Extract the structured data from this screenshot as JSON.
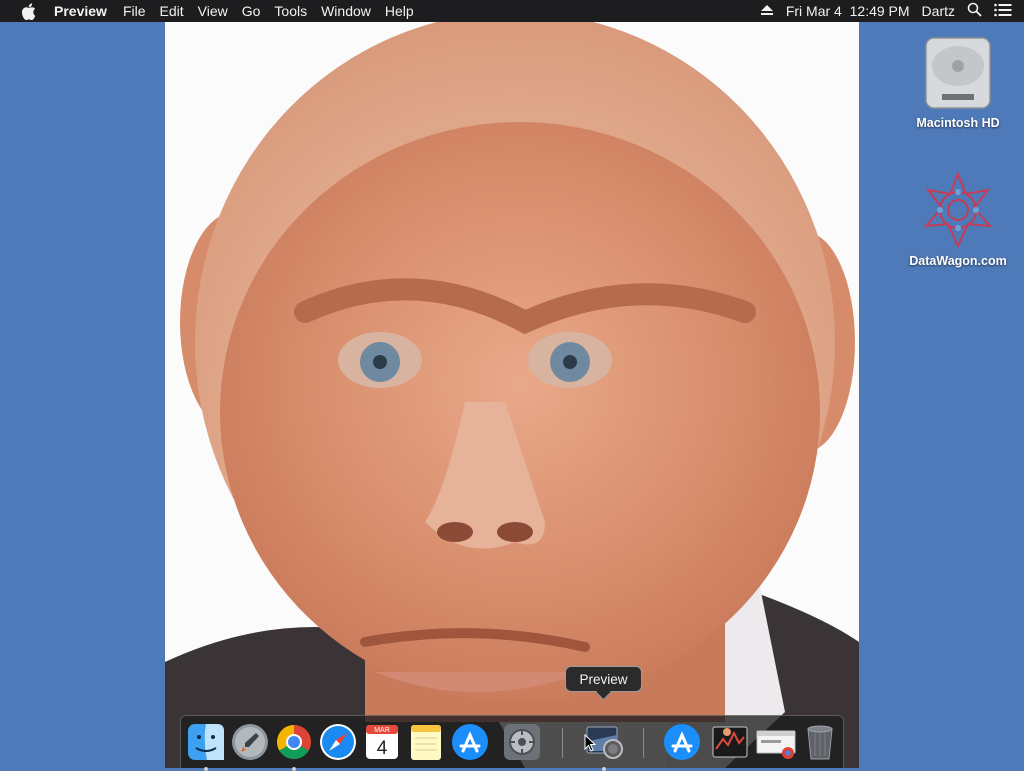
{
  "menubar": {
    "apple_icon": "apple-icon",
    "app_name": "Preview",
    "menus": [
      "File",
      "Edit",
      "View",
      "Go",
      "Tools",
      "Window",
      "Help"
    ],
    "status": {
      "eject_icon": "eject-icon",
      "datetime": "Fri Mar 4  12:49 PM",
      "user": "Dartz",
      "search_icon": "spotlight-search-icon",
      "list_icon": "notification-center-icon"
    }
  },
  "desktop": {
    "icons": [
      {
        "label": "Macintosh HD",
        "icon": "hard-drive-icon"
      },
      {
        "label": "DataWagon.com",
        "icon": "datawagon-icon"
      }
    ]
  },
  "dock": {
    "tooltip": "Preview",
    "calendar": {
      "month": "MAR",
      "day": "4"
    },
    "items": [
      {
        "name": "Finder",
        "icon": "finder-icon",
        "running": true
      },
      {
        "name": "Launchpad",
        "icon": "launchpad-icon",
        "running": false
      },
      {
        "name": "Google Chrome",
        "icon": "chrome-icon",
        "running": true
      },
      {
        "name": "Safari",
        "icon": "safari-icon",
        "running": false
      },
      {
        "name": "Calendar",
        "icon": "calendar-icon",
        "running": false
      },
      {
        "name": "Notes",
        "icon": "notes-icon",
        "running": false
      },
      {
        "name": "App Store",
        "icon": "app-store-icon",
        "running": false
      },
      {
        "name": "System Preferences",
        "icon": "system-preferences-icon",
        "running": false
      },
      {
        "name": "Preview",
        "icon": "preview-icon",
        "running": true
      },
      {
        "name": "App Store",
        "icon": "app-store-icon",
        "running": false
      },
      {
        "name": "Activity",
        "icon": "activity-monitor-icon",
        "running": false
      },
      {
        "name": "Chrome document",
        "icon": "chrome-document-icon",
        "running": false
      },
      {
        "name": "Trash",
        "icon": "trash-icon",
        "running": false
      }
    ]
  },
  "colors": {
    "desktop": "#4f7ab9",
    "menubar": "#1d1d1f",
    "dock": "#1e1e1e"
  }
}
